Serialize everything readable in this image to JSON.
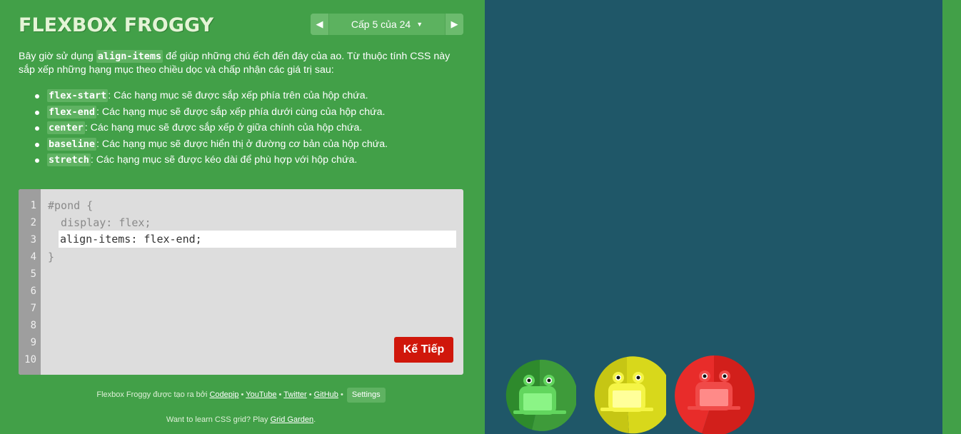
{
  "header": {
    "title": "FLEXBOX FROGGY",
    "level_label": "Cấp 5 của 24",
    "prev_icon": "left-arrow",
    "next_icon": "right-arrow",
    "caret_icon": "caret-down"
  },
  "instructions": {
    "before": "Bây giờ sử dụng ",
    "property": "align-items",
    "after": " để giúp những chú ếch đến đáy của ao. Từ thuộc tính CSS này sắp xếp những hạng mục theo chiều dọc và chấp nhận các giá trị sau:"
  },
  "values": [
    {
      "code": "flex-start",
      "text": ": Các hạng mục sẽ được sắp xếp phía trên của hộp chứa."
    },
    {
      "code": "flex-end",
      "text": ": Các hạng mục sẽ được sắp xếp phía dưới cùng của hộp chứa."
    },
    {
      "code": "center",
      "text": ": Các hạng mục sẽ được sắp xếp ở giữa chính của hộp chứa."
    },
    {
      "code": "baseline",
      "text": ": Các hạng mục sẽ được hiển thị ở đường cơ bản của hộp chứa."
    },
    {
      "code": "stretch",
      "text": ": Các hạng mục sẽ được kéo dài để phù hợp với hộp chứa."
    }
  ],
  "editor": {
    "line_numbers": [
      "1",
      "2",
      "3",
      "4",
      "5",
      "6",
      "7",
      "8",
      "9",
      "10"
    ],
    "line1": "#pond {",
    "line2": "  display: flex;",
    "input_value": "align-items: flex-end;",
    "line4": "}",
    "next_label": "Kế Tiếp"
  },
  "footer": {
    "credits_prefix": "Flexbox Froggy được tạo ra bởi",
    "codepip": "Codepip",
    "youtube": "YouTube",
    "twitter": "Twitter",
    "github": "GitHub",
    "separator": "•",
    "settings": "Settings",
    "promo_prefix": "Want to learn CSS grid? Play",
    "grid_garden": "Grid Garden",
    "promo_suffix": "."
  },
  "colors": {
    "sidebar": "#42a048",
    "board": "#1f5768",
    "next_button": "#d0170b",
    "frog_green": "#3e9b3a",
    "frog_yellow": "#c8c815",
    "frog_red": "#d21f1b"
  }
}
